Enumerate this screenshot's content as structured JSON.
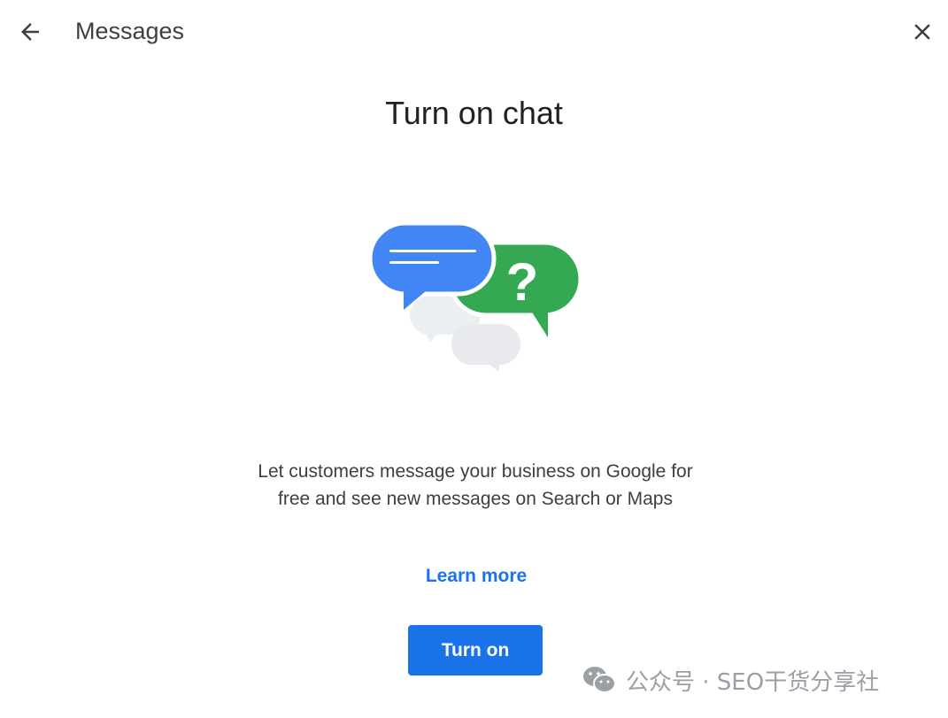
{
  "header": {
    "title": "Messages",
    "back_icon": "arrow-back-icon",
    "close_icon": "close-icon"
  },
  "main": {
    "heading": "Turn on chat",
    "illustration": "chat-bubbles-illustration",
    "description": "Let customers message your business on Google for free and see new messages on Search or Maps",
    "learn_more_label": "Learn more",
    "turn_on_label": "Turn on"
  },
  "watermark": {
    "text": "公众号 · SEO干货分享社",
    "icon": "wechat-icon"
  },
  "colors": {
    "accent_blue": "#1a73e8",
    "bubble_blue": "#4285f4",
    "bubble_green": "#34a853",
    "text_primary": "#202124",
    "text_secondary": "#3c4043"
  }
}
